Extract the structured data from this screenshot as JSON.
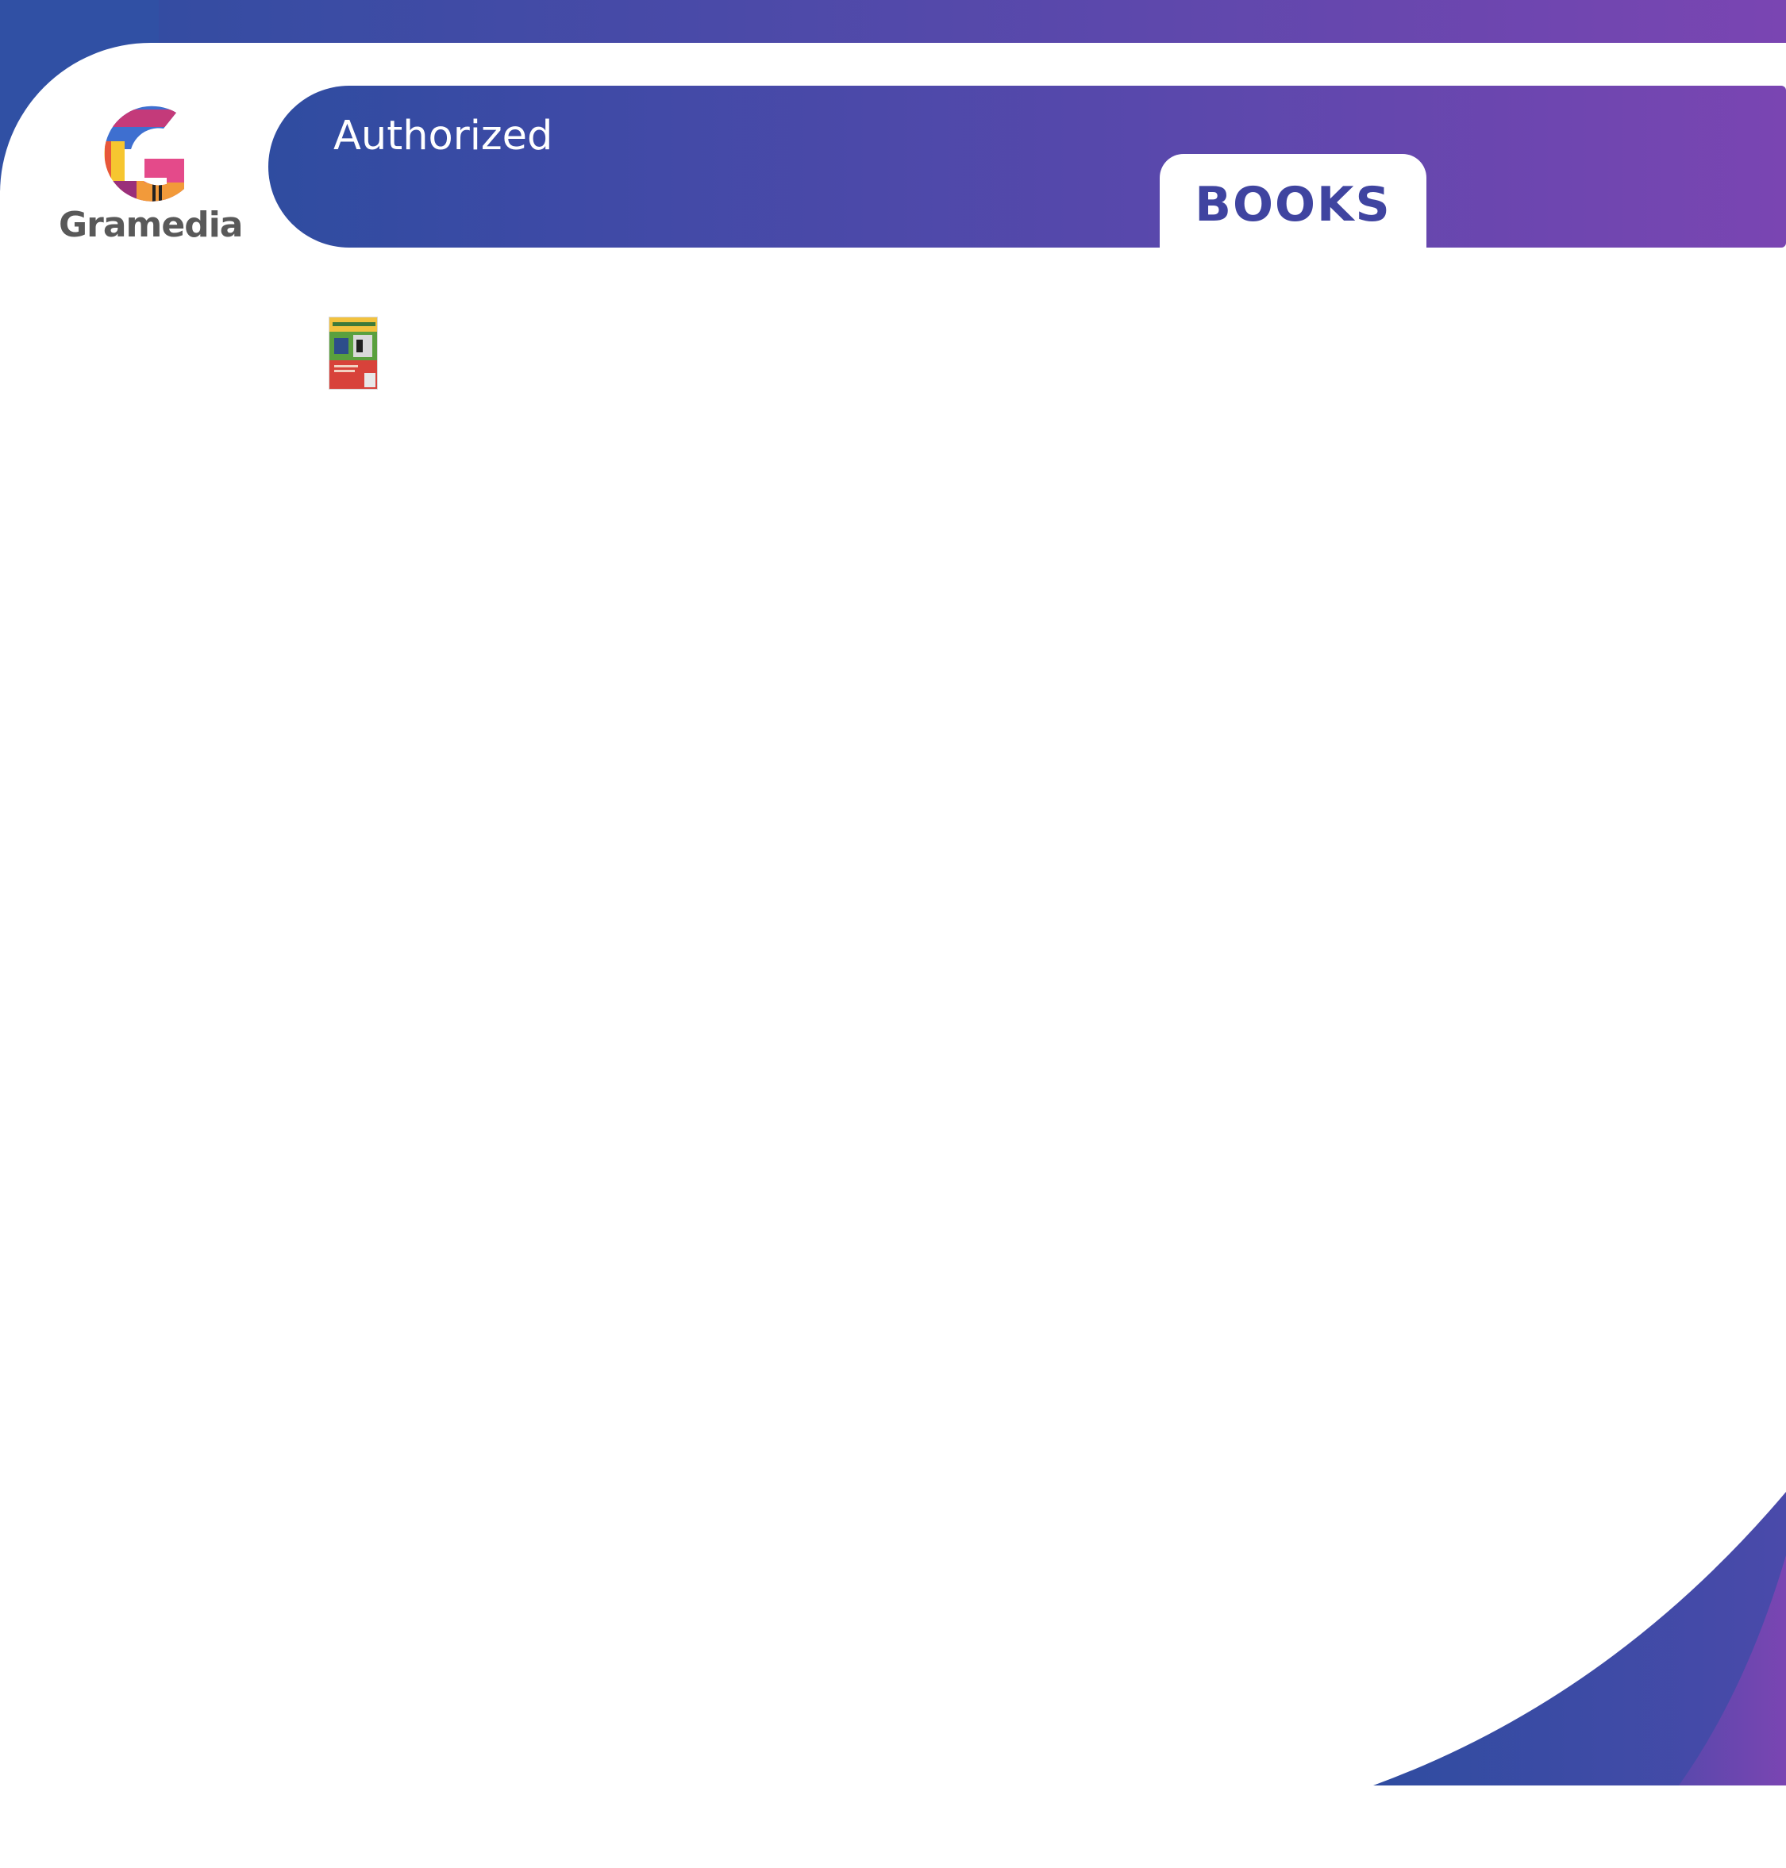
{
  "brand": {
    "name": "Gramedia",
    "logo_icon": "gramedia-g-logo-icon",
    "colors": {
      "gradient_start": "#2e4da0",
      "gradient_end": "#7a45b2",
      "tab_text": "#3f44a0",
      "logo_text": "#595959"
    }
  },
  "header": {
    "label": "Authorized",
    "tab_label": "BOOKS"
  },
  "content": {
    "book_thumbnail": "book-cover-thumbnail"
  }
}
